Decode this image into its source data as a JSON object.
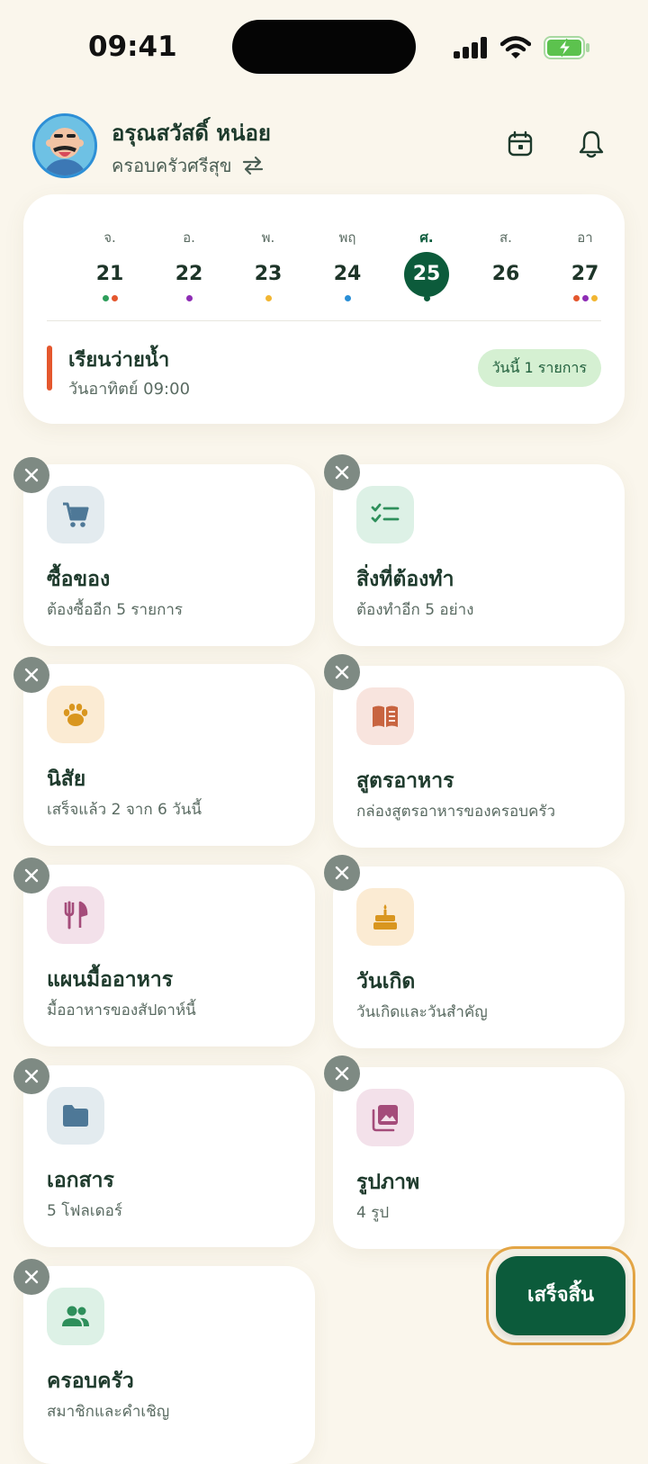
{
  "status_bar": {
    "time": "09:41",
    "icons": [
      "signal-icon",
      "wifi-icon",
      "battery-charging-icon"
    ]
  },
  "header": {
    "user_name": "อรุณสวัสดิ์ หน่อย",
    "family_name": "ครอบครัวศรีสุข",
    "icons": [
      "switch-family-icon",
      "calendar-icon",
      "bell-icon"
    ]
  },
  "calendar": {
    "days": [
      {
        "abbr": "จ.",
        "num": "21",
        "dots": [
          "#2E9E5B",
          "#E4572E"
        ]
      },
      {
        "abbr": "อ.",
        "num": "22",
        "dots": [
          "#8E2DB5"
        ]
      },
      {
        "abbr": "พ.",
        "num": "23",
        "dots": [
          "#F2B632"
        ]
      },
      {
        "abbr": "พฤ",
        "num": "24",
        "dots": [
          "#2A8FD6"
        ]
      },
      {
        "abbr": "ศ.",
        "num": "25",
        "dots": [
          "#0C5B3B"
        ],
        "selected": true
      },
      {
        "abbr": "ส.",
        "num": "26",
        "dots": []
      },
      {
        "abbr": "อา",
        "num": "27",
        "dots": [
          "#E4572E",
          "#8E2DB5",
          "#F2B632"
        ]
      }
    ],
    "event": {
      "title": "เรียนว่ายน้ำ",
      "time": "วันอาทิตย์ 09:00",
      "badge": "วันนี้ 1 รายการ",
      "accent": "#E4572E"
    }
  },
  "tiles": [
    {
      "title": "ซื้อของ",
      "subtitle": "ต้องซื้ออีก 5 รายการ",
      "icon": "cart-icon",
      "icon_bg": "#E3EBEF",
      "icon_color": "#4E7897"
    },
    {
      "title": "สิ่งที่ต้องทำ",
      "subtitle": "ต้องทำอีก 5 อย่าง",
      "icon": "checklist-icon",
      "icon_bg": "#DDF1E6",
      "icon_color": "#2E8F5B"
    },
    {
      "title": "นิสัย",
      "subtitle": "เสร็จแล้ว 2 จาก 6 วันนี้",
      "icon": "paw-icon",
      "icon_bg": "#FBEBD3",
      "icon_color": "#D9961F"
    },
    {
      "title": "สูตรอาหาร",
      "subtitle": "กล่องสูตรอาหารของครอบครัว",
      "icon": "book-icon",
      "icon_bg": "#F8E4DE",
      "icon_color": "#C86440"
    },
    {
      "title": "แผนมื้ออาหาร",
      "subtitle": "มื้ออาหารของสัปดาห์นี้",
      "icon": "utensils-icon",
      "icon_bg": "#F3E1EA",
      "icon_color": "#A44C7A"
    },
    {
      "title": "วันเกิด",
      "subtitle": "วันเกิดและวันสำคัญ",
      "icon": "cake-icon",
      "icon_bg": "#FBEBD3",
      "icon_color": "#D9961F"
    },
    {
      "title": "เอกสาร",
      "subtitle": "5 โฟลเดอร์",
      "icon": "folder-icon",
      "icon_bg": "#E3EBEF",
      "icon_color": "#4E7897"
    },
    {
      "title": "รูปภาพ",
      "subtitle": "4 รูป",
      "icon": "photos-icon",
      "icon_bg": "#F3E1EA",
      "icon_color": "#A44C7A"
    },
    {
      "title": "ครอบครัว",
      "subtitle": "สมาชิกและคำเชิญ",
      "icon": "people-icon",
      "icon_bg": "#DDF1E6",
      "icon_color": "#2E8F5B"
    }
  ],
  "done_button": {
    "label": "เสร็จสิ้น",
    "color": "#0C5B3B",
    "highlight": "#E3A545"
  }
}
